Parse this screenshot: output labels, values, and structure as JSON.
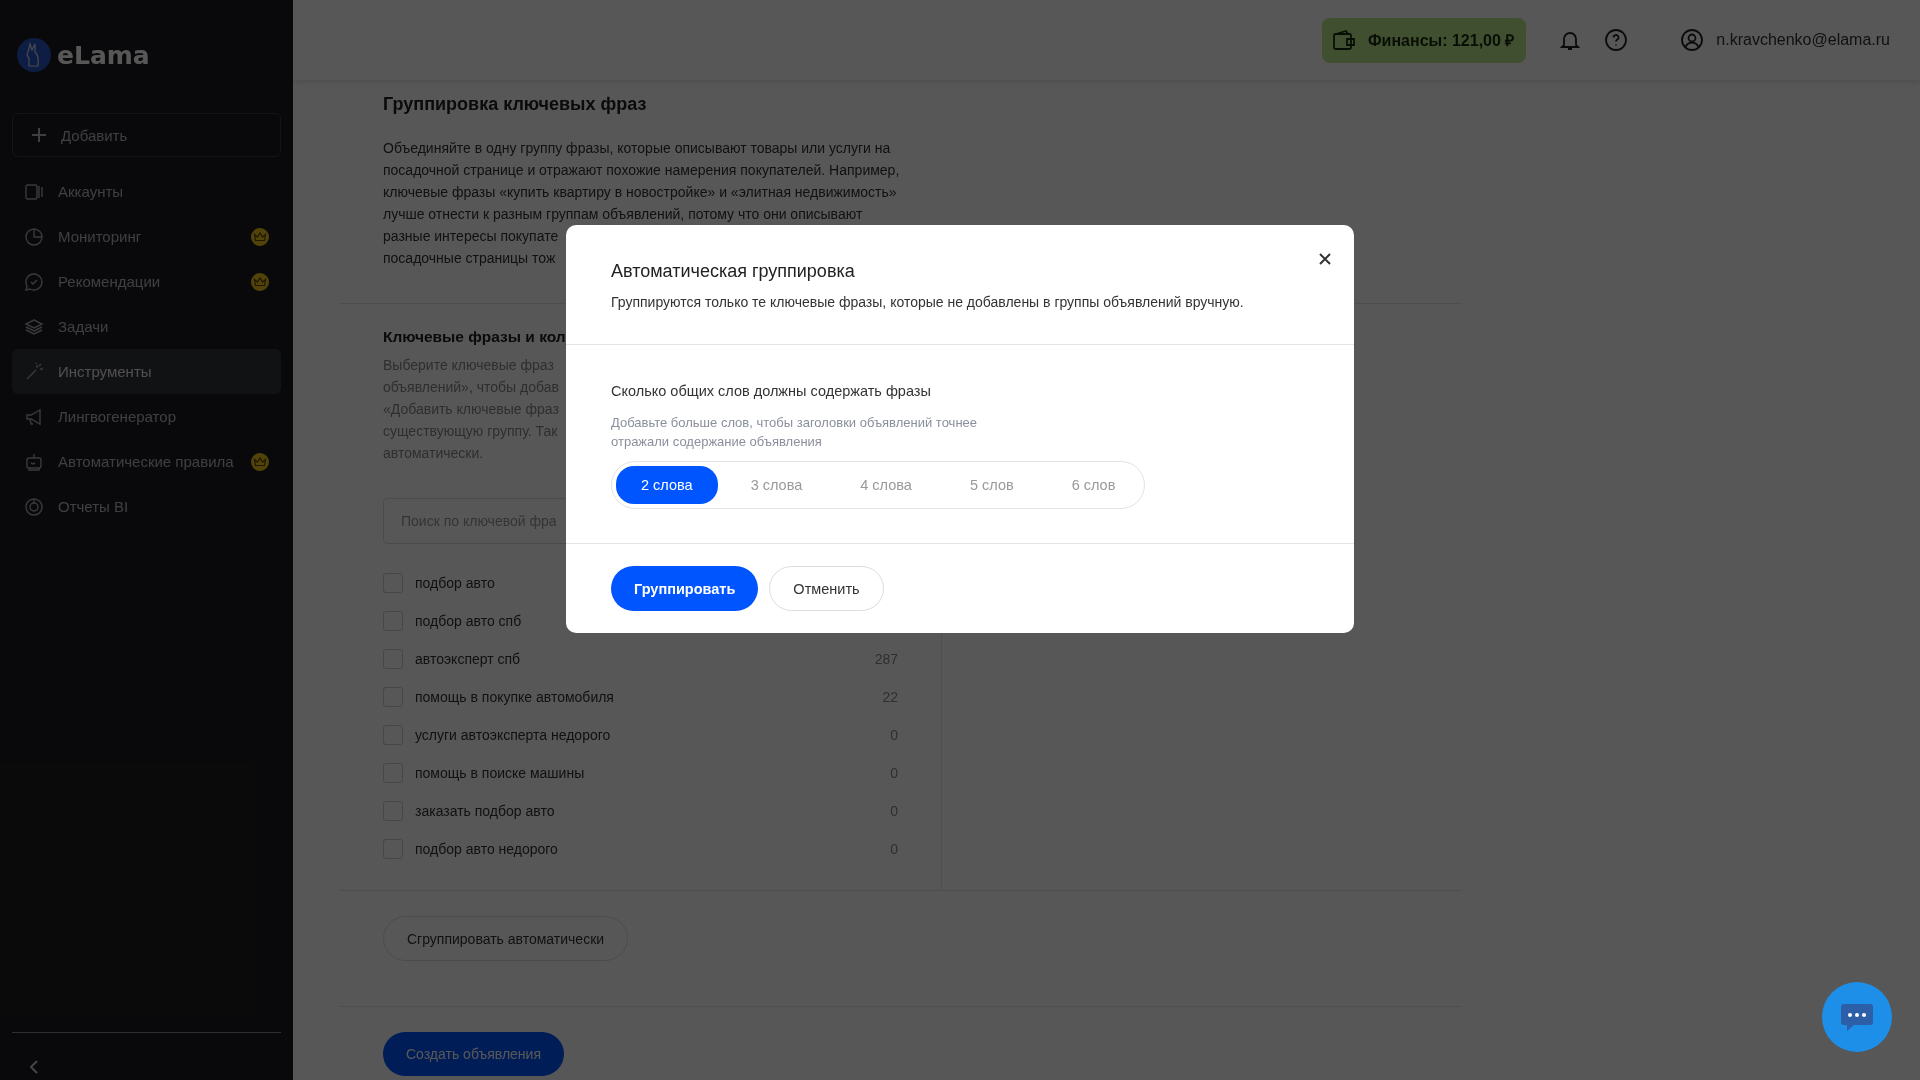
{
  "sidebar": {
    "logo": "eLama",
    "add_button": "Добавить",
    "items": [
      {
        "label": "Аккаунты",
        "selected": false,
        "premium": false
      },
      {
        "label": "Мониторинг",
        "selected": false,
        "premium": true
      },
      {
        "label": "Рекомендации",
        "selected": false,
        "premium": true
      },
      {
        "label": "Задачи",
        "selected": false,
        "premium": false
      },
      {
        "label": "Инструменты",
        "selected": true,
        "premium": false
      },
      {
        "label": "Лингвогенератор",
        "selected": false,
        "premium": false
      },
      {
        "label": "Автоматические правила",
        "selected": false,
        "premium": true
      },
      {
        "label": "Отчеты BI",
        "selected": false,
        "premium": false
      }
    ]
  },
  "header": {
    "finance": "Финансы: 121,00 ₽",
    "user": "n.kravchenko@elama.ru"
  },
  "content": {
    "title": "Группировка ключевых фраз",
    "paragraph": [
      "Объединяйте в одну группу фразы, которые описывают товары или услуги на",
      "посадочной странице и отражают похожие намерения покупателей. Например,",
      "ключевые фразы «купить квартиру в новостройке» и «элитная недвижимость»",
      "лучше отнести к разным группам объявлений, потому что они описывают",
      "разные интересы покупате",
      "посадочные страницы тож"
    ],
    "section_title": "Ключевые фразы и кол",
    "section_text": [
      "Выберите ключевые фраз",
      "объявлений», чтобы добав",
      "«Добавить ключевые фраз",
      "существующую группу. Так",
      "автоматически."
    ],
    "search": {
      "placeholder": "Поиск по ключевой фра"
    },
    "phrases": [
      {
        "text": "подбор авто",
        "checked": false
      },
      {
        "text": "подбор авто спб",
        "checked": false
      },
      {
        "text": "автоэксперт спб",
        "count": "287",
        "checked": false
      },
      {
        "text": "помощь в покупке автомобиля",
        "count": "22",
        "checked": false
      },
      {
        "text": "услуги автоэксперта недорого",
        "count": "0",
        "checked": false
      },
      {
        "text": "помощь в поиске машины",
        "count": "0",
        "checked": false
      },
      {
        "text": "заказать подбор авто",
        "count": "0",
        "checked": false
      },
      {
        "text": "подбор авто недорого",
        "count": "0",
        "checked": false
      }
    ],
    "auto_button": "Сгруппировать автоматически",
    "create_button": "Создать объявления"
  },
  "modal": {
    "title": "Автоматическая группировка",
    "subtitle": "Группируются только те ключевые фразы, которые не добавлены в группы объявлений вручную.",
    "question": "Сколько общих слов должны содержать фразы",
    "hint": "Добавьте больше слов, чтобы заголовки объявлений точнее отражали содержание объявления",
    "options": [
      {
        "label": "2 слова",
        "selected": true
      },
      {
        "label": "3 слова",
        "selected": false
      },
      {
        "label": "4 слова",
        "selected": false
      },
      {
        "label": "5 слов",
        "selected": false
      },
      {
        "label": "6 слов",
        "selected": false
      }
    ],
    "primary": "Группировать",
    "secondary": "Отменить"
  }
}
